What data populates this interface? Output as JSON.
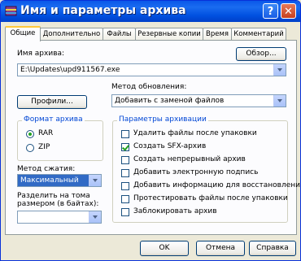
{
  "window": {
    "title": "Имя и параметры архива",
    "help": "?",
    "close": "✕"
  },
  "tabs": [
    "Общие",
    "Дополнительно",
    "Файлы",
    "Резервные копии",
    "Время",
    "Комментарий"
  ],
  "archive_name": {
    "label": "Имя архива:",
    "value": "E:\\Updates\\upd911567.exe",
    "browse": "Обзор..."
  },
  "update_method": {
    "label": "Метод обновления:",
    "value": "Добавить с заменой файлов"
  },
  "profiles": "Профили...",
  "format": {
    "title": "Формат архива",
    "options": [
      "RAR",
      "ZIP"
    ],
    "selected": "RAR"
  },
  "compression": {
    "label": "Метод сжатия:",
    "value": "Максимальный"
  },
  "split": {
    "label1": "Разделить на тома",
    "label2": "размером (в байтах):",
    "value": ""
  },
  "options": {
    "title": "Параметры архивации",
    "items": [
      {
        "label": "Удалить файлы после упаковки",
        "checked": false
      },
      {
        "label": "Создать SFX-архив",
        "checked": true
      },
      {
        "label": "Создать непрерывный архив",
        "checked": false
      },
      {
        "label": "Добавить электронную подпись",
        "checked": false
      },
      {
        "label": "Добавить информацию для восстановления",
        "checked": false
      },
      {
        "label": "Протестировать файлы после упаковки",
        "checked": false
      },
      {
        "label": "Заблокировать архив",
        "checked": false
      }
    ]
  },
  "buttons": {
    "ok": "OK",
    "cancel": "Отмена",
    "help": "Справка"
  },
  "colors": {
    "titlebar": "#0a58e8",
    "accent_green": "#21a121",
    "group_title": "#0046d5"
  }
}
